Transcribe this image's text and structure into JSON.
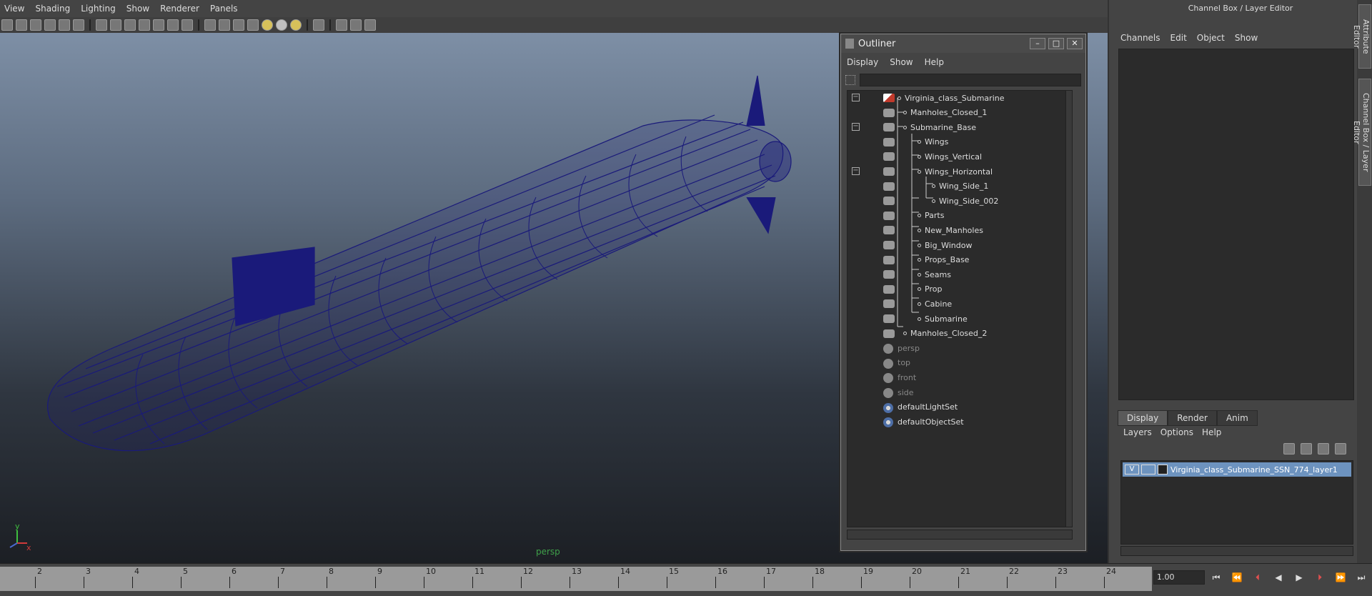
{
  "viewport": {
    "menu": [
      "View",
      "Shading",
      "Lighting",
      "Show",
      "Renderer",
      "Panels"
    ],
    "camera_label": "persp",
    "axis": {
      "y": "y",
      "x": "x"
    }
  },
  "outliner": {
    "title": "Outliner",
    "menu": [
      "Display",
      "Show",
      "Help"
    ],
    "rows": [
      {
        "label": "Virginia_class_Submarine",
        "depth": 0,
        "collapse": "−",
        "icon": "root",
        "dim": false
      },
      {
        "label": "Manholes_Closed_1",
        "depth": 1,
        "collapse": "",
        "icon": "mesh",
        "dim": false
      },
      {
        "label": "Submarine_Base",
        "depth": 1,
        "collapse": "−",
        "icon": "mesh",
        "dim": false
      },
      {
        "label": "Wings",
        "depth": 2,
        "collapse": "",
        "icon": "mesh",
        "dim": false
      },
      {
        "label": "Wings_Vertical",
        "depth": 2,
        "collapse": "",
        "icon": "mesh",
        "dim": false
      },
      {
        "label": "Wings_Horizontal",
        "depth": 2,
        "collapse": "−",
        "icon": "mesh",
        "dim": false
      },
      {
        "label": "Wing_Side_1",
        "depth": 3,
        "collapse": "",
        "icon": "mesh",
        "dim": false
      },
      {
        "label": "Wing_Side_002",
        "depth": 3,
        "collapse": "",
        "icon": "mesh",
        "dim": false
      },
      {
        "label": "Parts",
        "depth": 2,
        "collapse": "",
        "icon": "mesh",
        "dim": false
      },
      {
        "label": "New_Manholes",
        "depth": 2,
        "collapse": "",
        "icon": "mesh",
        "dim": false
      },
      {
        "label": "Big_Window",
        "depth": 2,
        "collapse": "",
        "icon": "mesh",
        "dim": false
      },
      {
        "label": "Props_Base",
        "depth": 2,
        "collapse": "",
        "icon": "mesh",
        "dim": false
      },
      {
        "label": "Seams",
        "depth": 2,
        "collapse": "",
        "icon": "mesh",
        "dim": false
      },
      {
        "label": "Prop",
        "depth": 2,
        "collapse": "",
        "icon": "mesh",
        "dim": false
      },
      {
        "label": "Cabine",
        "depth": 2,
        "collapse": "",
        "icon": "mesh",
        "dim": false
      },
      {
        "label": "Submarine",
        "depth": 2,
        "collapse": "",
        "icon": "mesh",
        "dim": false
      },
      {
        "label": "Manholes_Closed_2",
        "depth": 1,
        "collapse": "",
        "icon": "mesh",
        "dim": false
      },
      {
        "label": "persp",
        "depth": 0,
        "collapse": "",
        "icon": "cam",
        "dim": true
      },
      {
        "label": "top",
        "depth": 0,
        "collapse": "",
        "icon": "cam",
        "dim": true
      },
      {
        "label": "front",
        "depth": 0,
        "collapse": "",
        "icon": "cam",
        "dim": true
      },
      {
        "label": "side",
        "depth": 0,
        "collapse": "",
        "icon": "cam",
        "dim": true
      },
      {
        "label": "defaultLightSet",
        "depth": 0,
        "collapse": "",
        "icon": "set",
        "dim": false
      },
      {
        "label": "defaultObjectSet",
        "depth": 0,
        "collapse": "",
        "icon": "set",
        "dim": false
      }
    ]
  },
  "channel_box": {
    "title": "Channel Box / Layer Editor",
    "menu": [
      "Channels",
      "Edit",
      "Object",
      "Show"
    ],
    "layer_tabs": [
      "Display",
      "Render",
      "Anim"
    ],
    "layer_menu": [
      "Layers",
      "Options",
      "Help"
    ],
    "layer": {
      "visible": "V",
      "name": "Virginia_class_Submarine_SSN_774_layer1"
    },
    "side_tabs": [
      "Attribute Editor",
      "Channel Box / Layer Editor"
    ]
  },
  "timeline": {
    "ticks": [
      "2",
      "3",
      "4",
      "5",
      "6",
      "7",
      "8",
      "9",
      "10",
      "11",
      "12",
      "13",
      "14",
      "15",
      "16",
      "17",
      "18",
      "19",
      "20",
      "21",
      "22",
      "23",
      "24"
    ],
    "current_frame": "1.00"
  },
  "colors": {
    "wireframe": "#1a1a7a",
    "layer_highlight": "#6d93bf",
    "camera_label": "#3fa14a"
  }
}
